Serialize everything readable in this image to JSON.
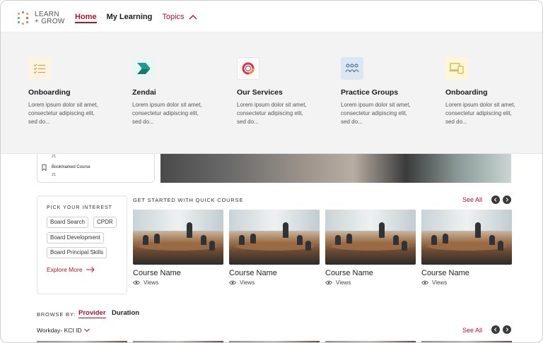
{
  "logo": {
    "line1": "LEARN",
    "line2": "+ GROW"
  },
  "nav": {
    "home": "Home",
    "my_learning": "My Learning",
    "topics": "Topics"
  },
  "mega_menu": [
    {
      "title": "Onboarding",
      "desc": "Lorem ipsum dolor sit amet, consectetur adipiscing elit, sed do...",
      "icon": "checklist-icon"
    },
    {
      "title": "Zendai",
      "desc": "Lorem ipsum dolor sit amet, consectetur adipiscing elit, sed do...",
      "icon": "zendai-logo-icon"
    },
    {
      "title": "Our Services",
      "desc": "Lorem ipsum dolor sit amet, consectetur adipiscing elit, sed do...",
      "icon": "ring-icon"
    },
    {
      "title": "Practice Groups",
      "desc": "Lorem ipsum dolor sit amet, consectetur adipiscing elit, sed do...",
      "icon": "people-group-icon"
    },
    {
      "title": "Onboarding",
      "desc": "Lorem ipsum dolor sit amet, consectetur adipiscing elit, sed do...",
      "icon": "devices-icon"
    }
  ],
  "hero_card": {
    "count_top": "21",
    "bookmarked": "Bookmarked Course",
    "count_bottom": "21"
  },
  "interest": {
    "caption": "PICK YOUR INTEREST",
    "chips": [
      "Board Search",
      "CPDR",
      "Board Development",
      "Board Principal Skills"
    ],
    "explore": "Explore More"
  },
  "quick_course": {
    "caption": "GET STARTED WITH QUICK COURSE",
    "see_all": "See All",
    "courses": [
      {
        "name": "Course Name",
        "views": "Views"
      },
      {
        "name": "Course Name",
        "views": "Views"
      },
      {
        "name": "Course Name",
        "views": "Views"
      },
      {
        "name": "Course Name",
        "views": "Views"
      }
    ]
  },
  "browse": {
    "caption": "BROWSE BY:",
    "tabs": [
      "Provider",
      "Duration"
    ],
    "filter": "Workday- KCI ID",
    "see_all": "See All"
  },
  "colors": {
    "accent": "#b3122e",
    "menu_bg": "#f3f3f3"
  }
}
